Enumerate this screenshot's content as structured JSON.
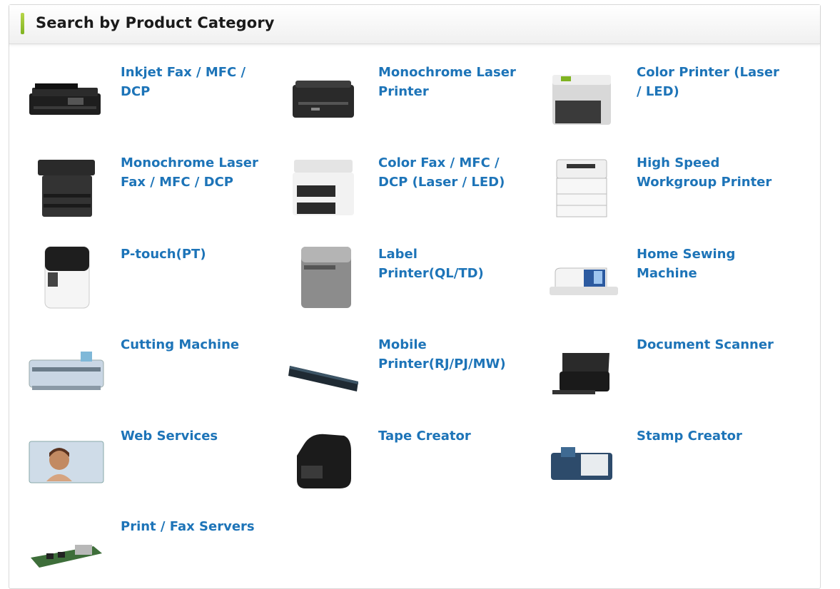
{
  "panel": {
    "title": "Search by Product Category"
  },
  "categories": [
    {
      "label": "Inkjet Fax / MFC / DCP",
      "icon": "inkjet-mfc-icon"
    },
    {
      "label": "Monochrome Laser Printer",
      "icon": "mono-laser-printer-icon"
    },
    {
      "label": "Color Printer (Laser / LED)",
      "icon": "color-printer-icon"
    },
    {
      "label": "Monochrome Laser Fax / MFC / DCP",
      "icon": "mono-laser-mfc-icon"
    },
    {
      "label": "Color Fax / MFC / DCP (Laser / LED)",
      "icon": "color-mfc-icon"
    },
    {
      "label": "High Speed Workgroup Printer",
      "icon": "workgroup-printer-icon"
    },
    {
      "label": "P-touch(PT)",
      "icon": "ptouch-icon"
    },
    {
      "label": "Label Printer(QL/TD)",
      "icon": "label-printer-icon"
    },
    {
      "label": "Home Sewing Machine",
      "icon": "sewing-machine-icon"
    },
    {
      "label": "Cutting Machine",
      "icon": "cutting-machine-icon"
    },
    {
      "label": "Mobile Printer(RJ/PJ/MW)",
      "icon": "mobile-printer-icon"
    },
    {
      "label": "Document Scanner",
      "icon": "document-scanner-icon"
    },
    {
      "label": "Web Services",
      "icon": "web-services-icon"
    },
    {
      "label": "Tape Creator",
      "icon": "tape-creator-icon"
    },
    {
      "label": "Stamp Creator",
      "icon": "stamp-creator-icon"
    },
    {
      "label": "Print / Fax Servers",
      "icon": "print-server-icon"
    }
  ],
  "colors": {
    "link": "#1d74b8",
    "accent": "#8dc02c"
  }
}
